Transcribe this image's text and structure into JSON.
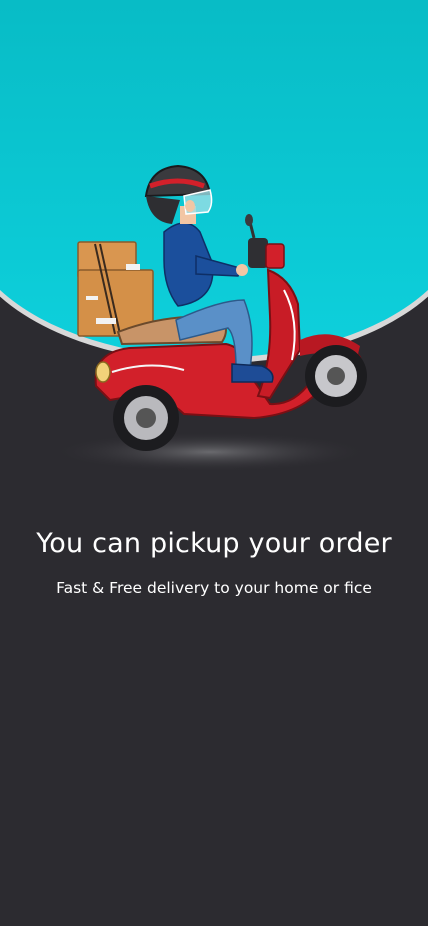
{
  "onboarding": {
    "title": "You can pickup your order",
    "subtitle": "Fast & Free delivery to your home or fice"
  },
  "theme": {
    "background": "#2c2b30",
    "hero": "#0ac6d0",
    "scooter": "#d4202a",
    "rider_shirt": "#1b4f9c",
    "boxes": "#d9954f"
  }
}
